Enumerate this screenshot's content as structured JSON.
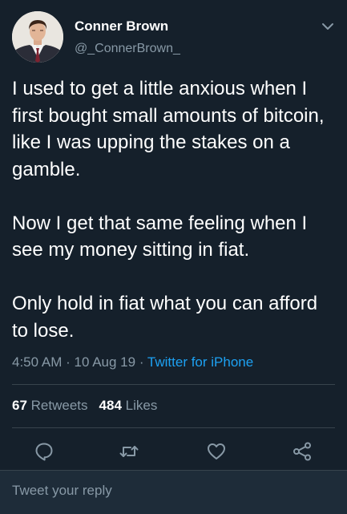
{
  "author": {
    "display_name": "Conner Brown",
    "handle": "@_ConnerBrown_",
    "avatar_icon": "profile-photo"
  },
  "tweet": {
    "paragraphs": [
      "I used to get a little anxious when I first bought small amounts of bitcoin, like I was upping the stakes on a gamble.",
      "Now I get that same feeling when I see my money sitting in fiat.",
      "Only hold in fiat what you can afford to lose."
    ],
    "time": "4:50 AM",
    "date": "10 Aug 19",
    "separator": "·",
    "source": "Twitter for iPhone"
  },
  "stats": {
    "retweets_count": "67",
    "retweets_label": "Retweets",
    "likes_count": "484",
    "likes_label": "Likes"
  },
  "actions": [
    {
      "icon": "reply-icon"
    },
    {
      "icon": "retweet-icon"
    },
    {
      "icon": "like-icon"
    },
    {
      "icon": "share-icon"
    }
  ],
  "reply": {
    "placeholder": "Tweet your reply"
  },
  "colors": {
    "background": "#15202b",
    "text": "#ffffff",
    "secondary_text": "#8899a6",
    "link": "#1da1f2",
    "divider": "#38444d",
    "reply_bar": "#1e2c39"
  }
}
